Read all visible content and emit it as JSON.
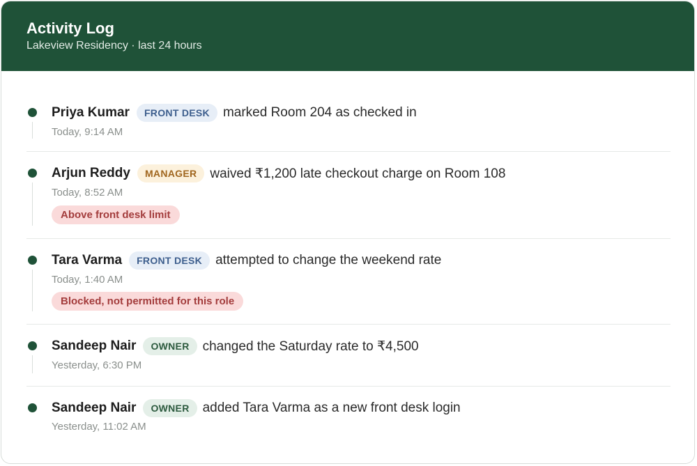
{
  "header": {
    "title": "Activity Log",
    "subtitle": "Lakeview Residency · last 24 hours"
  },
  "entries": [
    {
      "actor": "Priya Kumar",
      "role": "FRONT DESK",
      "action": "marked Room 204 as checked in",
      "time": "Today, 9:14 AM",
      "flag": ""
    },
    {
      "actor": "Arjun Reddy",
      "role": "MANAGER",
      "action": "waived ₹1,200 late checkout charge on Room 108",
      "time": "Today, 8:52 AM",
      "flag": "Above front desk limit"
    },
    {
      "actor": "Tara Varma",
      "role": "FRONT DESK",
      "action": "attempted to change the weekend rate",
      "time": "Today, 1:40 AM",
      "flag": "Blocked, not permitted for this role"
    },
    {
      "actor": "Sandeep Nair",
      "role": "OWNER",
      "action": "changed the Saturday rate to ₹4,500",
      "time": "Yesterday, 6:30 PM",
      "flag": ""
    },
    {
      "actor": "Sandeep Nair",
      "role": "OWNER",
      "action": "added Tara Varma as a new front desk login",
      "time": "Yesterday, 11:02 AM",
      "flag": ""
    }
  ],
  "colors": {
    "header_bg": "#1f5238",
    "dot": "#1f5238",
    "role_front_desk": "#3d5e8d",
    "role_manager": "#a0661f",
    "role_owner": "#2c5a3e",
    "flag_bg": "#fadada",
    "flag_text": "#a33c3c"
  }
}
